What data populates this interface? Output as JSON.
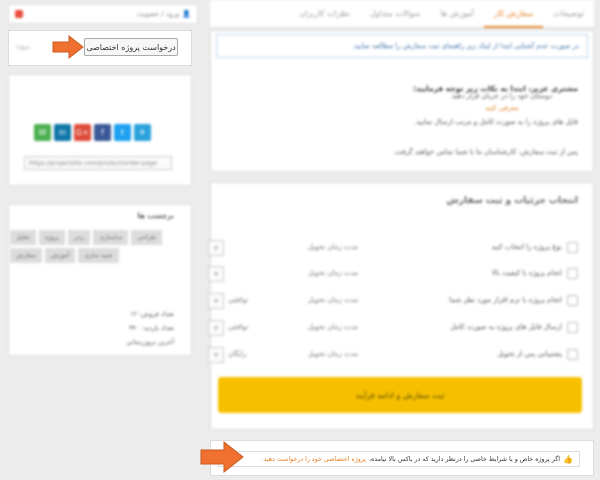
{
  "top": {
    "tabs": [
      "توضیحات",
      "سفارش کار",
      "آموزش ها",
      "سوالات متداول",
      "نظرات کاربران"
    ],
    "active_tab_index": 1,
    "user_label": "ورود / عضویت"
  },
  "main": {
    "notice": "در صورت عدم آشنایی ابتدا از لینک زیر راهنمای ثبت سفارش را مطالعه نمایید.",
    "intro_title": "مشتری عزیز، ابتدا به نکات زیر توجه فرمایید:",
    "intro_lines": [
      "فایل های پروژه را به صورت کامل و مرتب ارسال نمایید.",
      "پس از ثبت سفارش، کارشناسان ما با شما تماس خواهند گرفت."
    ],
    "options_title": "انتخاب جزئیات و ثبت سفارش",
    "options": [
      {
        "label": "نوع پروژه را انتخاب کنید",
        "duration": "مدت زمان تحویل"
      },
      {
        "label": "انجام پروژه با کیفیت بالا",
        "duration": "مدت زمان تحویل"
      },
      {
        "label": "انجام پروژه با نرم افزار مورد نظر شما",
        "duration": "مدت زمان تحویل",
        "price": "توافقی"
      },
      {
        "label": "ارسال فایل های پروژه به صورت کامل",
        "duration": "مدت زمان تحویل",
        "price": "توافقی"
      },
      {
        "label": "پشتیبانی پس از تحویل",
        "duration": "مدت زمان تحویل",
        "price": "رایگان"
      }
    ],
    "submit_label": "ثبت سفارش و ادامه فرآیند",
    "bottom_note_text": "اگر پروژه خاص و یا شرایط خاصی را درنظر دارید که در باکس بالا نیامده،",
    "bottom_note_link": "پروژه اختصاصی خود را درخواست دهید."
  },
  "sidebar": {
    "request_button": "درخواست پروژه اختصاصی",
    "request_hint": "پروژه",
    "share_text_1": "دوستان خود را در جریان قرار دهید",
    "share_text_2": "معرفی کنید",
    "share_url": "https://projectsite.com/product/order-page",
    "tags_title": "برچسب ها",
    "tags": [
      "طراحی",
      "مدلسازی",
      "رندر",
      "پروژه",
      "تحلیل",
      "شبیه سازی",
      "آموزش",
      "سفارش"
    ],
    "stats": [
      "تعداد فروش: ۱۲",
      "تعداد بازدید: ۳۴۰",
      "آخرین بروزرسانی"
    ]
  },
  "colors": {
    "accent": "#e67e22",
    "submit": "#f6c000",
    "arrow": "#f07030"
  }
}
